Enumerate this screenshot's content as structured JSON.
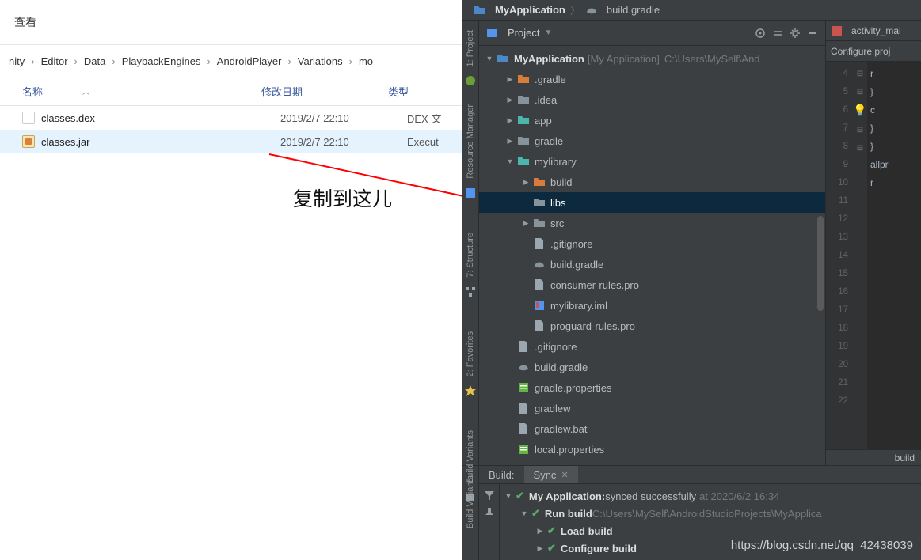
{
  "explorer": {
    "menu_view": "查看",
    "breadcrumb": [
      "nity",
      "Editor",
      "Data",
      "PlaybackEngines",
      "AndroidPlayer",
      "Variations",
      "mo"
    ],
    "columns": {
      "name": "名称",
      "date": "修改日期",
      "type": "类型"
    },
    "rows": [
      {
        "icon": "dex",
        "name": "classes.dex",
        "date": "2019/2/7 22:10",
        "type": "DEX 文",
        "selected": false
      },
      {
        "icon": "jar",
        "name": "classes.jar",
        "date": "2019/2/7 22:10",
        "type": "Execut",
        "selected": true
      }
    ]
  },
  "annotation": {
    "text": "复制到这儿"
  },
  "ide": {
    "top_breadcrumb": {
      "project": "MyApplication",
      "file": "build.gradle"
    },
    "rails": {
      "project": "1: Project",
      "resource_manager": "Resource Manager",
      "structure": "7: Structure",
      "favorites": "2: Favorites",
      "build_variants": "Build Variants"
    },
    "project_panel": {
      "dropdown": "Project",
      "root": {
        "name": "MyApplication",
        "hint": "[My Application]",
        "path": "C:\\Users\\MySelf\\And"
      },
      "tree": [
        {
          "d": 1,
          "exp": "▶",
          "icon": "fold-orange",
          "label": ".gradle"
        },
        {
          "d": 1,
          "exp": "▶",
          "icon": "fold-gray",
          "label": ".idea"
        },
        {
          "d": 1,
          "exp": "▶",
          "icon": "fold-teal",
          "label": "app"
        },
        {
          "d": 1,
          "exp": "▶",
          "icon": "fold-gray",
          "label": "gradle"
        },
        {
          "d": 1,
          "exp": "▼",
          "icon": "fold-teal",
          "label": "mylibrary"
        },
        {
          "d": 2,
          "exp": "▶",
          "icon": "fold-orange",
          "label": "build"
        },
        {
          "d": 2,
          "exp": "",
          "icon": "fold-gray",
          "label": "libs",
          "selected": true
        },
        {
          "d": 2,
          "exp": "▶",
          "icon": "fold-gray",
          "label": "src"
        },
        {
          "d": 2,
          "exp": "",
          "icon": "file-gray",
          "label": ".gitignore"
        },
        {
          "d": 2,
          "exp": "",
          "icon": "gradle",
          "label": "build.gradle"
        },
        {
          "d": 2,
          "exp": "",
          "icon": "file-gray",
          "label": "consumer-rules.pro"
        },
        {
          "d": 2,
          "exp": "",
          "icon": "iml",
          "label": "mylibrary.iml"
        },
        {
          "d": 2,
          "exp": "",
          "icon": "file-gray",
          "label": "proguard-rules.pro"
        },
        {
          "d": 1,
          "exp": "",
          "icon": "file-gray",
          "label": ".gitignore"
        },
        {
          "d": 1,
          "exp": "",
          "icon": "gradle",
          "label": "build.gradle"
        },
        {
          "d": 1,
          "exp": "",
          "icon": "props",
          "label": "gradle.properties"
        },
        {
          "d": 1,
          "exp": "",
          "icon": "file-gray",
          "label": "gradlew"
        },
        {
          "d": 1,
          "exp": "",
          "icon": "file-gray",
          "label": "gradlew.bat"
        },
        {
          "d": 1,
          "exp": "",
          "icon": "props",
          "label": "local.properties"
        }
      ]
    },
    "editor": {
      "tab": "activity_mai",
      "subbar": "Configure proj",
      "line_numbers": [
        4,
        5,
        6,
        7,
        8,
        9,
        10,
        11,
        12,
        13,
        14,
        15,
        16,
        17,
        18,
        19,
        20,
        21,
        22
      ],
      "code_frag": [
        "r",
        "",
        "",
        "",
        "}",
        "c",
        "",
        "",
        "",
        "",
        "}",
        "}",
        "",
        "allpr",
        "r",
        "",
        "",
        "",
        ""
      ],
      "footer": "build"
    },
    "build": {
      "tab_build": "Build:",
      "tab_sync": "Sync",
      "rows": [
        {
          "d": 0,
          "exp": "▼",
          "ok": true,
          "text": "My Application:",
          "tail": "synced successfully",
          "time": "at 2020/6/2 16:34"
        },
        {
          "d": 1,
          "exp": "▼",
          "ok": true,
          "text": "Run build",
          "path": "C:\\Users\\MySelf\\AndroidStudioProjects\\MyApplica"
        },
        {
          "d": 2,
          "exp": "▶",
          "ok": true,
          "text": "Load build"
        },
        {
          "d": 2,
          "exp": "▶",
          "ok": true,
          "text": "Configure build"
        }
      ]
    }
  },
  "watermark": "https://blog.csdn.net/qq_42438039"
}
